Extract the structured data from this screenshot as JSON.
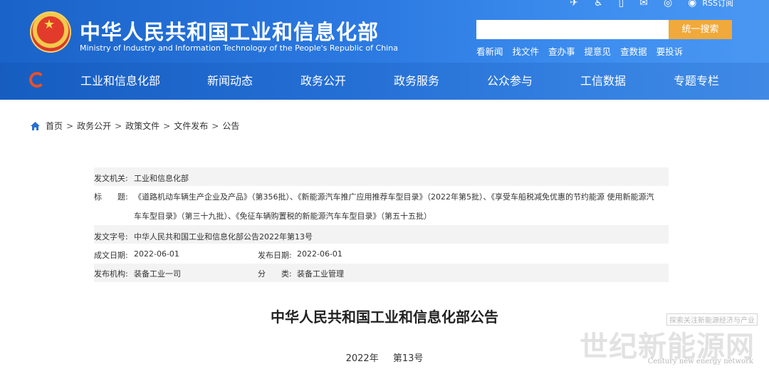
{
  "header": {
    "title_cn": "中华人民共和国工业和信息化部",
    "title_en": "Ministry of Industry and Information Technology of the People's Republic of China",
    "rss_label": "RSS订阅",
    "top_icons": [
      "bird-icon",
      "accessibility-icon",
      "mobile-icon",
      "mail-icon",
      "wechat-icon",
      "weibo-icon",
      "rss-icon"
    ]
  },
  "search": {
    "placeholder": "",
    "button_label": "统一搜索"
  },
  "quick_links": [
    "看新闻",
    "找文件",
    "查办事",
    "提意见",
    "查数据",
    "要投诉"
  ],
  "nav": {
    "items": [
      "工业和信息化部",
      "新闻动态",
      "政务公开",
      "政务服务",
      "公众参与",
      "工信数据",
      "专题专栏"
    ]
  },
  "breadcrumb": [
    "首页",
    "政务公开",
    "政策文件",
    "文件发布",
    "公告"
  ],
  "info": {
    "issuer_label": "发文机关:",
    "issuer": "工业和信息化部",
    "title_label": "标　　题:",
    "title_line1": "《道路机动车辆生产企业及产品》（第356批）、《新能源汽车推广应用推荐车型目录》（2022年第5批）、《享受车船税减免优惠的节约能源 使用新能源汽",
    "title_line2": "车车型目录》（第三十九批）、《免征车辆购置税的新能源汽车车型目录》（第五十五批）",
    "docno_label": "发文字号:",
    "docno": "中华人民共和国工业和信息化部公告2022年第13号",
    "written_label": "成文日期:",
    "written_date": "2022-06-01",
    "published_label": "发布日期:",
    "published_date": "2022-06-01",
    "org_label": "发布机构:",
    "org": "装备工业一司",
    "category_label": "分　　类:",
    "category": "装备工业管理"
  },
  "document": {
    "title": "中华人民共和国工业和信息化部公告",
    "year": "2022年",
    "number": "第13号"
  },
  "watermark": {
    "top": "探索关注新能源经济与产业",
    "main": "世纪新能源网",
    "en": "Century new energy network"
  },
  "colors": {
    "header_blue": "#2a78e0",
    "search_button": "#f0a93a",
    "row_shade": "#f3f3f3"
  }
}
